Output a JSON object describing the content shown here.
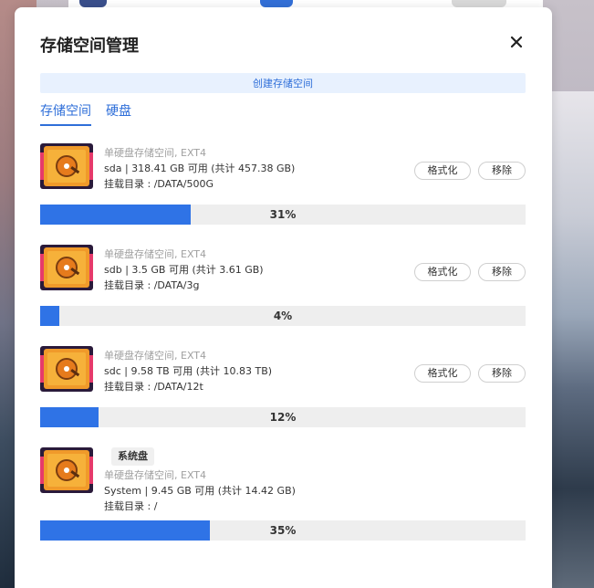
{
  "dialog": {
    "title": "存储空间管理",
    "close_icon": "close-icon",
    "create_button_label": "创建存储空间",
    "tabs": [
      {
        "label": "存储空间",
        "active": true
      },
      {
        "label": "硬盘",
        "active": false
      }
    ]
  },
  "colors": {
    "accent": "#2f73e6",
    "bar_track": "#eeeeee",
    "create_bg": "#e8f1fe"
  },
  "storage": [
    {
      "icon": "hard-disk-icon",
      "type_line": "单硬盘存储空间, EXT4",
      "capacity_line": "sda | 318.41 GB 可用 (共计 457.38 GB)",
      "mount_line": "挂载目录 : /DATA/500G",
      "format_label": "格式化",
      "remove_label": "移除",
      "usage_percent": 31,
      "usage_text": "31%"
    },
    {
      "icon": "hard-disk-icon",
      "type_line": "单硬盘存储空间, EXT4",
      "capacity_line": "sdb | 3.5 GB 可用 (共计 3.61 GB)",
      "mount_line": "挂载目录 : /DATA/3g",
      "format_label": "格式化",
      "remove_label": "移除",
      "usage_percent": 4,
      "usage_text": "4%"
    },
    {
      "icon": "hard-disk-icon",
      "type_line": "单硬盘存储空间, EXT4",
      "capacity_line": "sdc | 9.58 TB 可用 (共计 10.83 TB)",
      "mount_line": "挂载目录 : /DATA/12t",
      "format_label": "格式化",
      "remove_label": "移除",
      "usage_percent": 12,
      "usage_text": "12%"
    },
    {
      "icon": "hard-disk-icon",
      "badge": "系统盘",
      "type_line": "单硬盘存储空间, EXT4",
      "capacity_line": "System | 9.45 GB 可用 (共计 14.42 GB)",
      "mount_line": "挂载目录 : /",
      "usage_percent": 35,
      "usage_text": "35%"
    }
  ]
}
